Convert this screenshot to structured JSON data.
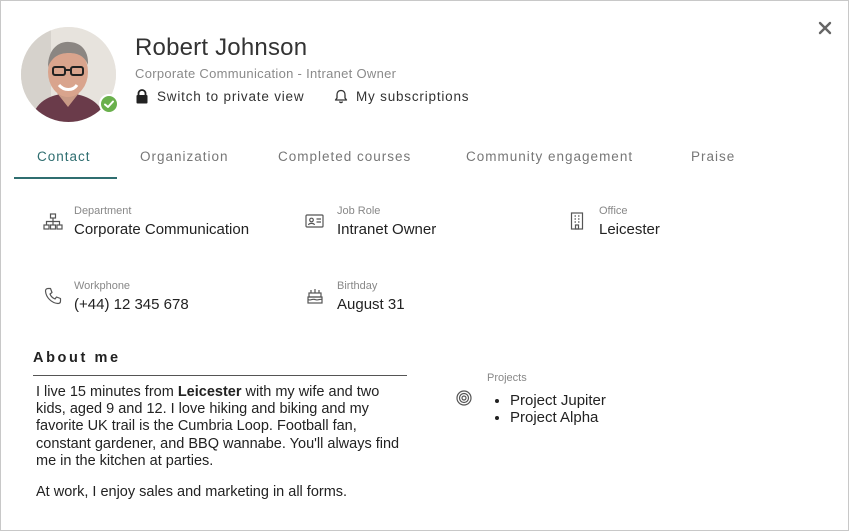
{
  "profile": {
    "name": "Robert Johnson",
    "subtitle": "Corporate Communication - Intranet Owner",
    "status": "online-verified"
  },
  "actions": {
    "private_view": "Switch to private view",
    "subscriptions": "My subscriptions"
  },
  "tabs": [
    {
      "label": "Contact",
      "active": true
    },
    {
      "label": "Organization",
      "active": false
    },
    {
      "label": "Completed courses",
      "active": false
    },
    {
      "label": "Community engagement",
      "active": false
    },
    {
      "label": "Praise",
      "active": false
    }
  ],
  "contact": {
    "department": {
      "label": "Department",
      "value": "Corporate Communication",
      "icon": "org-chart-icon"
    },
    "job_role": {
      "label": "Job Role",
      "value": "Intranet Owner",
      "icon": "id-card-icon"
    },
    "office": {
      "label": "Office",
      "value": "Leicester",
      "icon": "building-icon"
    },
    "workphone": {
      "label": "Workphone",
      "value": "(+44) 12 345 678",
      "icon": "phone-icon"
    },
    "birthday": {
      "label": "Birthday",
      "value": "August 31",
      "icon": "birthday-cake-icon"
    }
  },
  "about": {
    "title": "About me",
    "p1_before": "I live 15 minutes from ",
    "p1_bold": "Leicester",
    "p1_after": " with my wife and two kids, aged 9 and 12. I love hiking and biking and my favorite UK trail is the Cumbria Loop. Football fan, constant gardener, and BBQ wannabe. You'll always find me in the kitchen at parties.",
    "p2": "At work, I enjoy sales and marketing in all forms."
  },
  "projects": {
    "label": "Projects",
    "items": [
      "Project Jupiter",
      "Project Alpha"
    ],
    "icon": "target-icon"
  },
  "colors": {
    "accent": "#2f6e70",
    "status_green": "#6ab04c"
  }
}
